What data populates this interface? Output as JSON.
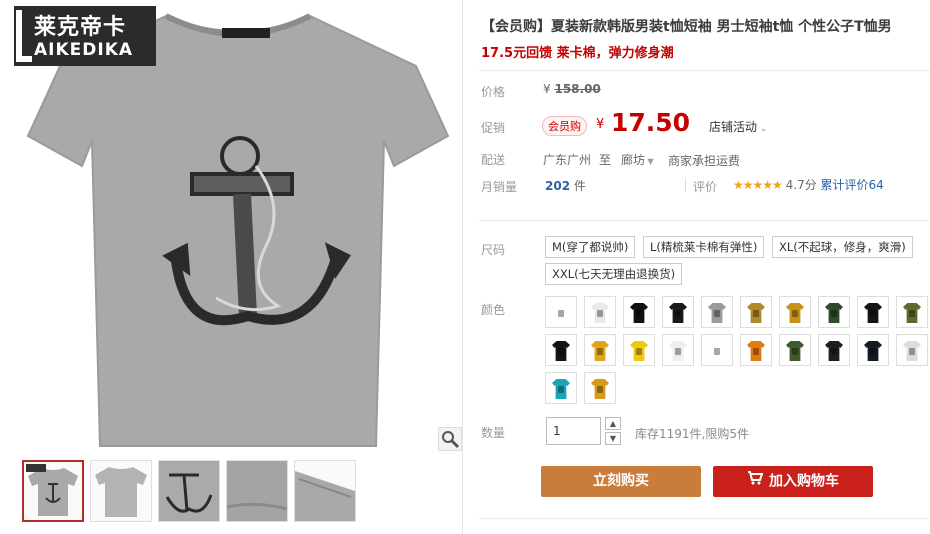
{
  "brand": {
    "name_cn": "莱克帝卡",
    "name_en": "AIKEDIKA"
  },
  "product": {
    "title": "【会员购】夏装新款韩版男装t恤短袖 男士短袖t恤 个性公子T恤男",
    "subtitle": "17.5元回馈 莱卡棉，弹力修身潮"
  },
  "price": {
    "label": "价格",
    "currency": "¥",
    "original": "158.00"
  },
  "promo": {
    "label": "促销",
    "tag": "会员购",
    "currency": "¥",
    "value": "17.50",
    "store_activity": "店铺活动"
  },
  "delivery": {
    "label": "配送",
    "from": "广东广州",
    "to_word": "至",
    "to": "廊坊",
    "shipping": "商家承担运费"
  },
  "sales": {
    "label": "月销量",
    "count": "202",
    "unit": "件",
    "rating_label": "评价",
    "stars": "★★★★★",
    "score": "4.7分",
    "cumulative": "累计评价64"
  },
  "size": {
    "label": "尺码",
    "options": [
      "M(穿了都说帅)",
      "L(精梳莱卡棉有弹性)",
      "XL(不起球，修身，爽滑)",
      "XXL(七天无理由退换货)"
    ]
  },
  "color": {
    "label": "颜色",
    "swatches": [
      "#ffffff",
      "#e8e8e8",
      "#111111",
      "#1a1a1a",
      "#9a9a9a",
      "#b08a2a",
      "#c8921a",
      "#2f4a2a",
      "#151515",
      "#5b6b2a",
      "#141414",
      "#e0a41a",
      "#f2c80f",
      "#eeeeee",
      "#ffffff",
      "#e07a12",
      "#3f5a2f",
      "#1e1e1e",
      "#141a24",
      "#dcdcdc",
      "#1ba3b8",
      "#d99a1a"
    ]
  },
  "quantity": {
    "label": "数量",
    "value": "1",
    "up": "▲",
    "down": "▼",
    "stock": "库存1191件,限购5件"
  },
  "actions": {
    "buy_now": "立刻购买",
    "add_cart": "加入购物车"
  }
}
